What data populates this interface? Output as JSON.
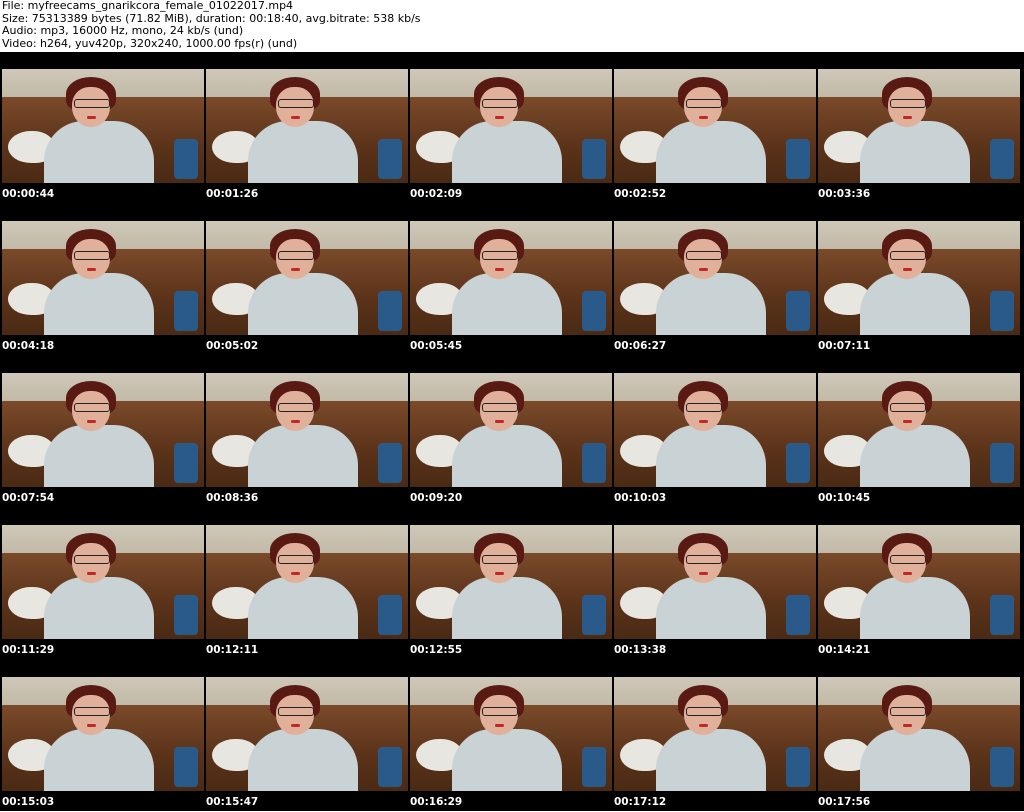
{
  "info": {
    "file": "File: myfreecams_gnarikcora_female_01022017.mp4",
    "size": "Size: 75313389 bytes (71.82 MiB), duration: 00:18:40, avg.bitrate: 538 kb/s",
    "audio": "Audio: mp3, 16000 Hz, mono, 24 kb/s (und)",
    "video": "Video: h264, yuv420p, 320x240, 1000.00 fps(r) (und)"
  },
  "thumbnails": [
    "00:00:44",
    "00:01:26",
    "00:02:09",
    "00:02:52",
    "00:03:36",
    "00:04:18",
    "00:05:02",
    "00:05:45",
    "00:06:27",
    "00:07:11",
    "00:07:54",
    "00:08:36",
    "00:09:20",
    "00:10:03",
    "00:10:45",
    "00:11:29",
    "00:12:11",
    "00:12:55",
    "00:13:38",
    "00:14:21",
    "00:15:03",
    "00:15:47",
    "00:16:29",
    "00:17:12",
    "00:17:56"
  ]
}
